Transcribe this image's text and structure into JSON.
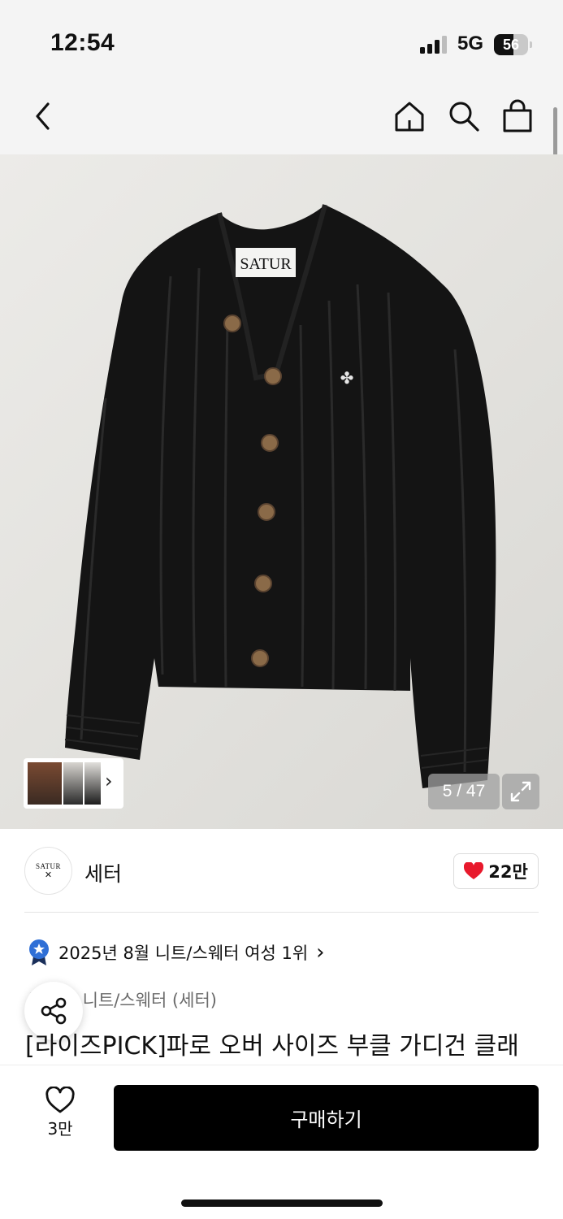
{
  "status_bar": {
    "time": "12:54",
    "network": "5G",
    "battery": "56",
    "battery_level": 0.56
  },
  "nav": {
    "back_icon": "chevron-left-icon",
    "home_icon": "home-icon",
    "search_icon": "search-icon",
    "cart_icon": "shopping-bag-icon"
  },
  "gallery": {
    "counter": "5 / 47",
    "expand_icon": "expand-icon",
    "garment_label": "SATUR",
    "thumb_arrow": "›"
  },
  "brand": {
    "logo_text": "SATUR",
    "name": "세터",
    "likes": "22만"
  },
  "rank": {
    "text": "2025년 8월 니트/스웨터 여성 1위",
    "arrow": "›"
  },
  "product": {
    "category": "상의 > 니트/스웨터 (세터)",
    "title": "[라이즈PICK]파로 오버 사이즈 부클 가디건 클래"
  },
  "bottom": {
    "wish_count": "3만",
    "buy_label": "구매하기"
  },
  "colors": {
    "accent_heart": "#e8192c",
    "buy_button": "#000000",
    "rank_badge": "#2f6fd6"
  }
}
